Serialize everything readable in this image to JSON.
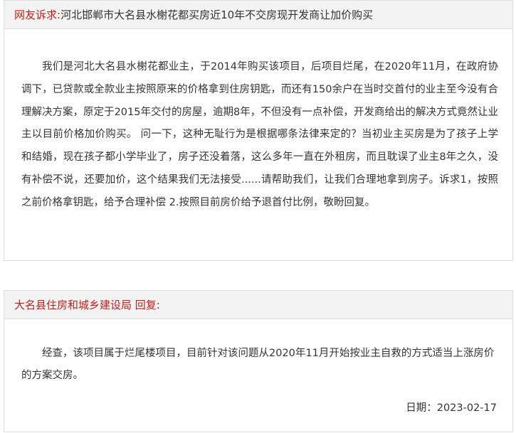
{
  "complaint": {
    "label": "网友诉求:",
    "title": "河北邯郸市大名县水榭花都买房近10年不交房现开发商让加价购买",
    "content": "我们是河北大名县水榭花都业主，于2014年购买该项目，后项目烂尾，在2020年11月，在政府协调下，已贷款或全款业主按照原来的价格拿到住房钥匙，而还有150余户在当时交首付的业主至今没有合理解决方案，原定于2015年交付的房屋，逾期8年，不但没有一点补偿，开发商给出的解决方式竟然让业主以目前价格加价购买。 问一下，这种无耻行为是根据哪条法律来定的？当初业主买房是为了孩子上学和结婚，现在孩子都小学毕业了，房子还没着落，这么多年一直在外租房，而且耽误了业主8年之久，没有补偿不说，还要加价，这个结果我们无法接受......请帮助我们，让我们合理地拿到房子。诉求1，按照之前价格拿钥匙，给予合理补偿 2.按照目前房价给予退首付比例，敬盼回复。"
  },
  "reply": {
    "department": "大名县住房和城乡建设局 回复:",
    "content": "经查，该项目属于烂尾楼项目，目前针对该问题从2020年11月开始按业主自救的方式适当上涨房价的方案交房。",
    "date_label": "日期：",
    "date": "2023-02-17"
  },
  "colors": {
    "label_red": "#c0201a",
    "header_bg": "#f3f3f3",
    "border": "#dcdcdc",
    "text": "#333333"
  }
}
